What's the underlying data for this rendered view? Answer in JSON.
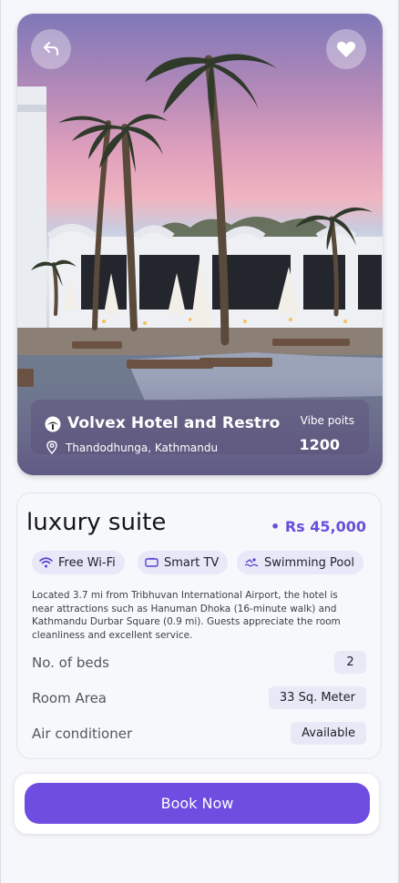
{
  "hotel": {
    "name": "Volvex Hotel and Restro",
    "location": "Thandodhunga, Kathmandu",
    "vibe_label": "Vibe poits",
    "vibe_value": "1200"
  },
  "room": {
    "title": "luxury suite",
    "price": "• Rs 45,000",
    "amenities": [
      {
        "label": "Free Wi-Fi",
        "icon": "wifi-icon"
      },
      {
        "label": "Smart TV",
        "icon": "tv-icon"
      },
      {
        "label": "Swimming Pool",
        "icon": "pool-icon"
      }
    ],
    "description": "Located 3.7 mi from Tribhuvan International Airport, the hotel is near attractions such as Hanuman Dhoka (16-minute walk) and Kathmandu Durbar Square (0.9 mi). Guests appreciate the room cleanliness and excellent service.",
    "specs": [
      {
        "label": "No. of beds",
        "value": "2"
      },
      {
        "label": "Room Area",
        "value": "33 Sq. Meter"
      },
      {
        "label": "Air conditioner",
        "value": "Available"
      }
    ]
  },
  "actions": {
    "book_label": "Book Now"
  },
  "icons": {
    "back": "back-arrow-icon",
    "favorite": "heart-icon",
    "location": "location-pin-icon"
  },
  "colors": {
    "accent": "#6e4de0",
    "price": "#6a4fd8",
    "chip_bg": "#e7e8f8"
  }
}
